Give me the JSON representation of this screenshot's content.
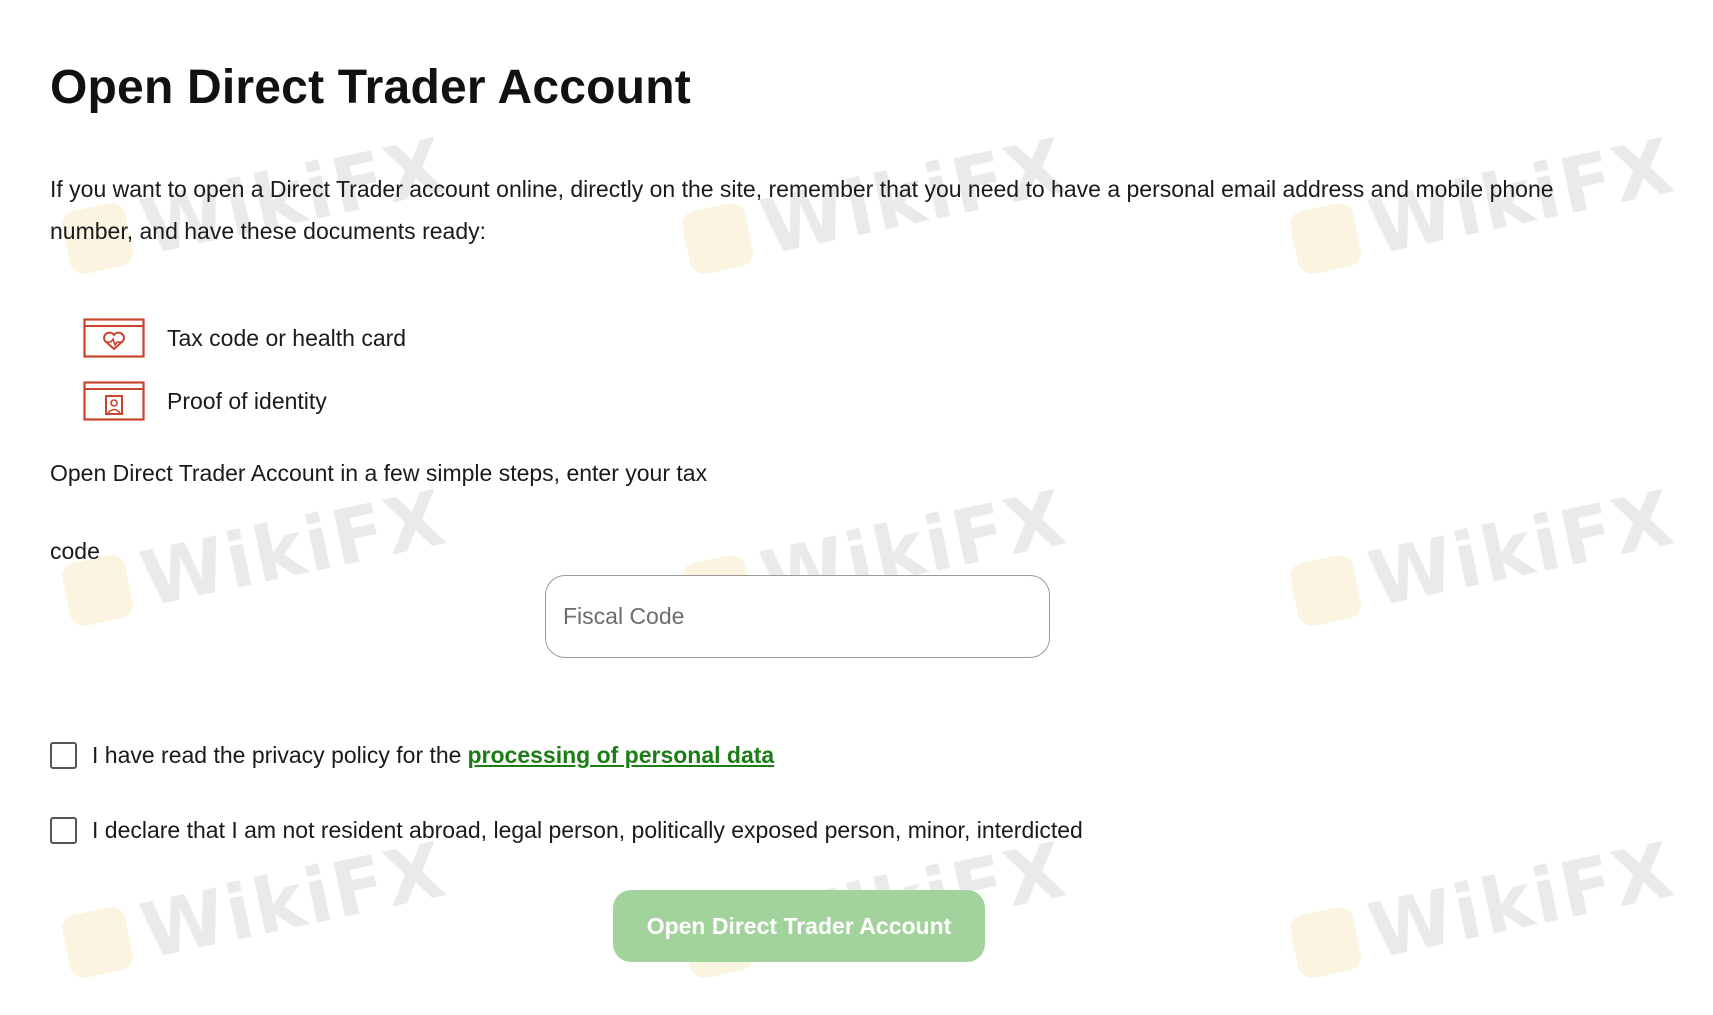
{
  "page": {
    "title": "Open Direct Trader Account",
    "intro": "If you want to open a Direct Trader account online, directly on the site, remember that you need to have a personal email address and mobile phone number, and have these documents ready:",
    "documents": [
      {
        "label": "Tax code or health card",
        "icon": "health-card-icon"
      },
      {
        "label": "Proof of identity",
        "icon": "id-card-icon"
      }
    ],
    "steps_text": "Open Direct Trader Account in a few simple steps, enter your tax",
    "steps_text_2": "code"
  },
  "form": {
    "fiscal_code_placeholder": "Fiscal Code",
    "fiscal_code_value": "",
    "privacy_prefix": "I have read the privacy policy for the",
    "privacy_link": "processing of personal data",
    "declaration": "I declare that I am not resident abroad, legal person, politically exposed person, minor, interdicted",
    "privacy_checked": false,
    "declaration_checked": false,
    "submit_label": "Open Direct Trader Account"
  },
  "watermark": {
    "text": "WikiFX"
  },
  "colors": {
    "accent_icon": "#c8452c",
    "link": "#1c7d17",
    "button_disabled": "#a3d39c"
  }
}
